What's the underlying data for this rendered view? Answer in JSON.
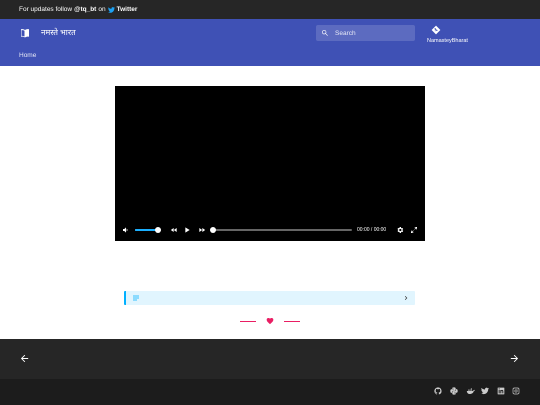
{
  "announcement": {
    "prefix": "For updates follow",
    "handle": "@tq_bt",
    "on": "on",
    "network": "Twitter"
  },
  "header": {
    "site_title": "नमस्ते भारत",
    "search_placeholder": "Search",
    "repo_name": "NamasteyBharat",
    "nav_home": "Home"
  },
  "video": {
    "volume_level": 0.9,
    "progress": 0,
    "current_time": "00:00",
    "separator": "/",
    "duration": "00:00"
  },
  "admonition": {
    "icon": "note-icon",
    "collapsed": true
  },
  "footer": {
    "prev_icon": "arrow-left-icon",
    "next_icon": "arrow-right-icon",
    "social_icons": [
      "github-icon",
      "python-icon",
      "docker-icon",
      "twitter-icon",
      "linkedin-icon",
      "instagram-icon"
    ]
  },
  "colors": {
    "header_bg": "#3f51b5",
    "announce_bg": "#262626",
    "accent": "#e91e63",
    "admonition_border": "#00b0ff",
    "volume_fill": "#1aafff"
  }
}
